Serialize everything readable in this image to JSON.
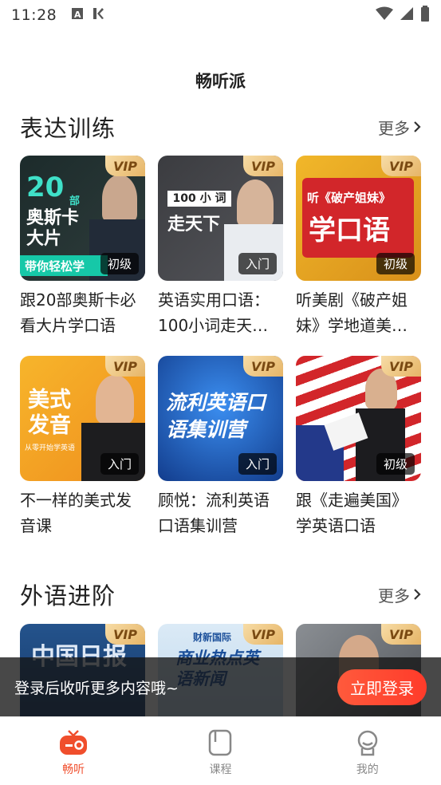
{
  "status_bar": {
    "time": "11:28"
  },
  "page_title": "畅听派",
  "sections": [
    {
      "title": "表达训练",
      "more_label": "更多",
      "cards": [
        {
          "title": "跟20部奥斯卡必看大片学口语",
          "level": "初级",
          "vip": "VIP",
          "thumb_text": "20部奥斯卡必看大片",
          "thumb_sub": "带你轻松学",
          "bg": "#1d2a2a"
        },
        {
          "title": "英语实用口语：100小词走天…",
          "level": "入门",
          "vip": "VIP",
          "thumb_text": "100小词走天下",
          "thumb_sub": "",
          "bg": "#3a3a3e"
        },
        {
          "title": "听美剧《破产姐妹》学地道美…",
          "level": "初级",
          "vip": "VIP",
          "thumb_text": "学口语",
          "thumb_sub": "听《破产姐妹》",
          "bg": "#e4a21b"
        }
      ]
    },
    {
      "title": "",
      "more_label": "",
      "cards": [
        {
          "title": "不一样的美式发音课",
          "level": "入门",
          "vip": "VIP",
          "thumb_text": "美式发音",
          "thumb_sub": "从零开始学英语",
          "bg": "#f2a21f"
        },
        {
          "title": "顾悦：流利英语口语集训营",
          "level": "入门",
          "vip": "VIP",
          "thumb_text": "流利英语口语集训营",
          "thumb_sub": "",
          "bg": "#1f5cc0"
        },
        {
          "title": "跟《走遍美国》学英语口语",
          "level": "初级",
          "vip": "VIP",
          "thumb_text": "",
          "thumb_sub": "",
          "bg": "#2b3e8a"
        }
      ]
    },
    {
      "title": "外语进阶",
      "more_label": "更多",
      "cards": [
        {
          "title": "",
          "level": "",
          "vip": "VIP",
          "thumb_text": "中国日报",
          "thumb_sub": "",
          "bg": "#1b3d6e"
        },
        {
          "title": "",
          "level": "",
          "vip": "VIP",
          "thumb_text": "商业热点英语新闻",
          "thumb_sub": "财新国际",
          "bg": "#cfe3f2"
        },
        {
          "title": "",
          "level": "",
          "vip": "VIP",
          "thumb_text": "",
          "thumb_sub": "",
          "bg": "#6b6f74"
        }
      ]
    }
  ],
  "login_banner": {
    "text": "登录后收听更多内容哦~",
    "button": "立即登录"
  },
  "bottom_nav": [
    {
      "label": "畅听",
      "icon": "radio-icon",
      "active": true
    },
    {
      "label": "课程",
      "icon": "course-icon",
      "active": false
    },
    {
      "label": "我的",
      "icon": "profile-icon",
      "active": false
    }
  ],
  "colors": {
    "accent": "#f04e2c",
    "vip_gold": "#e6b567"
  }
}
